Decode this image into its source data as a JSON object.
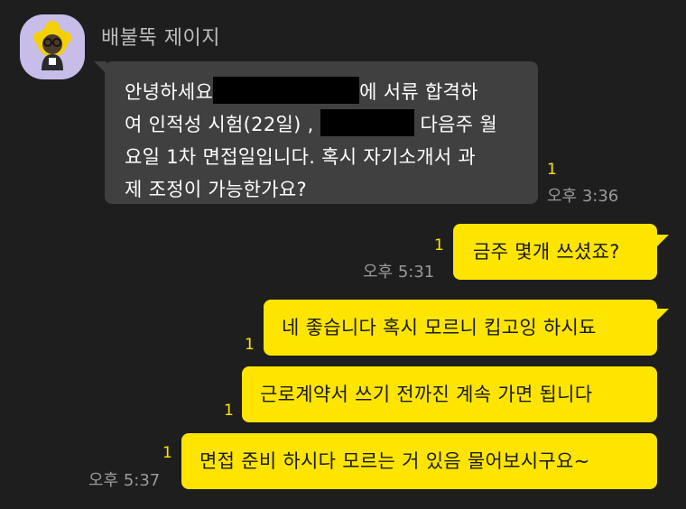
{
  "sender": {
    "name": "배불뚝 제이지"
  },
  "messages": [
    {
      "direction": "incoming",
      "lines": {
        "l1a": "안녕하세요",
        "l1b": "에 서류 합격하",
        "l2a": "여 인적성 시험(22일) ,",
        "l2b": "다음주 월",
        "l3": "요일 1차 면접일입니다. 혹시 자기소개서 과",
        "l4": "제 조정이 가능한가요?"
      },
      "unread": "1",
      "time": "오후 3:36"
    },
    {
      "direction": "outgoing",
      "text": "금주 몇개 쓰셨죠?",
      "unread": "1",
      "time": "오후 5:31"
    },
    {
      "direction": "outgoing",
      "text": "네 좋습니다 혹시 모르니 킵고잉 하시됴",
      "unread": "1"
    },
    {
      "direction": "outgoing",
      "text": "근로계약서 쓰기 전까진 계속 가면 됩니다",
      "unread": "1"
    },
    {
      "direction": "outgoing",
      "text": "면접 준비 하시다 모르는 거 있음 물어보시구요~",
      "unread": "1",
      "time": "오후 5:37"
    }
  ],
  "colors": {
    "background": "#1e1e1e",
    "incoming_bubble": "#404040",
    "outgoing_bubble": "#fee500",
    "avatar_bg": "#c8bde9"
  }
}
